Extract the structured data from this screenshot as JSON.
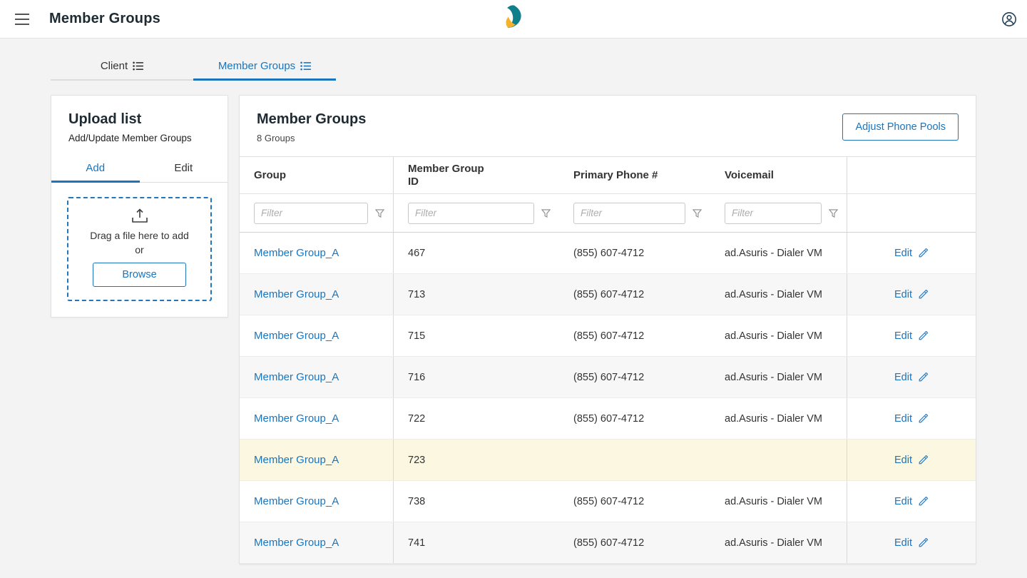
{
  "header": {
    "title": "Member Groups"
  },
  "nav": {
    "client_tab": "Client",
    "member_groups_tab": "Member Groups"
  },
  "upload": {
    "title": "Upload list",
    "subtitle": "Add/Update Member Groups",
    "tab_add": "Add",
    "tab_edit": "Edit",
    "drop_text": "Drag a file here to add",
    "or_text": "or",
    "browse_label": "Browse"
  },
  "groups_panel": {
    "title": "Member Groups",
    "count": "8 Groups",
    "adjust_button": "Adjust Phone Pools",
    "filter_placeholder": "Filter",
    "columns": {
      "group": "Group",
      "id": "Member Group ID",
      "phone": "Primary Phone #",
      "voicemail": "Voicemail"
    },
    "edit_label": "Edit",
    "rows": [
      {
        "group": "Member Group_A",
        "id": "467",
        "phone": "(855) 607-4712",
        "voicemail": "ad.Asuris - Dialer VM"
      },
      {
        "group": "Member Group_A",
        "id": "713",
        "phone": "(855) 607-4712",
        "voicemail": "ad.Asuris - Dialer VM"
      },
      {
        "group": "Member Group_A",
        "id": "715",
        "phone": "(855) 607-4712",
        "voicemail": "ad.Asuris - Dialer VM"
      },
      {
        "group": "Member Group_A",
        "id": "716",
        "phone": "(855) 607-4712",
        "voicemail": "ad.Asuris - Dialer VM"
      },
      {
        "group": "Member Group_A",
        "id": "722",
        "phone": "(855) 607-4712",
        "voicemail": "ad.Asuris - Dialer VM"
      },
      {
        "group": "Member Group_A",
        "id": "723",
        "phone": "",
        "voicemail": "",
        "highlight": true
      },
      {
        "group": "Member Group_A",
        "id": "738",
        "phone": "(855) 607-4712",
        "voicemail": "ad.Asuris - Dialer VM"
      },
      {
        "group": "Member Group_A",
        "id": "741",
        "phone": "(855) 607-4712",
        "voicemail": "ad.Asuris - Dialer VM"
      }
    ]
  },
  "colors": {
    "accent": "#1b74bc",
    "stripe_row": "#f7f7f7",
    "highlight_row": "#fbf7e1",
    "logo_teal": "#0f7f8b",
    "logo_yellow": "#f3b229"
  },
  "icons": {
    "hamburger": "menu-icon",
    "account": "account-icon",
    "list": "list-icon",
    "upload": "upload-icon",
    "filter": "filter-funnel-icon",
    "pencil": "pencil-icon"
  }
}
